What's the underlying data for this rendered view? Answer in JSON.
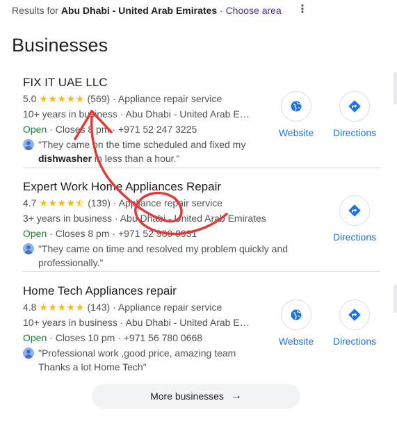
{
  "header": {
    "results_prefix": "Results for ",
    "location": "Abu Dhabi - United Arab Emirates",
    "separator": " · ",
    "choose_area": "Choose area",
    "menu_icon": "more-vert-icon"
  },
  "section_title": "Businesses",
  "businesses": [
    {
      "name": "FIX IT UAE LLC",
      "rating": "5.0",
      "stars": "★★★★★",
      "reviews": "(569)",
      "category": "Appliance repair service",
      "experience": "10+ years in business",
      "address": "Abu Dhabi - United Arab E…",
      "status": "Open",
      "hours": "Closes 8 pm",
      "phone": "+971 52 247 3225",
      "review_text": "\"They came on the time scheduled and fixed my ",
      "review_bold": "dishwasher",
      "review_tail": " in less than a hour.\"",
      "website_label": "Website",
      "directions_label": "Directions"
    },
    {
      "name": "Expert Work Home Appliances Repair",
      "rating": "4.7",
      "stars": "★★★★⯪",
      "reviews": "(139)",
      "category": "Appliance repair service",
      "experience": "3+ years in business",
      "address": "Abu Dhabi - United Arab Emirates",
      "status": "Open",
      "hours": "Closes 8 pm",
      "phone": "+971 52 980 0931",
      "review_text": "\"They came on time and resolved my problem quickly and professionally.\"",
      "directions_label": "Directions"
    },
    {
      "name": "Home Tech Appliances repair",
      "rating": "4.8",
      "stars": "★★★★★",
      "reviews": "(143)",
      "category": "Appliance repair service",
      "experience": "10+ years in business",
      "address": "Abu Dhabi - United Arab E…",
      "status": "Open",
      "hours": "Closes 10 pm",
      "phone": "+971 56 780 0668",
      "review_text": "\"Professional work ,good price, amazing team Thanks a lot Home Tech\"",
      "website_label": "Website",
      "directions_label": "Directions"
    }
  ],
  "more_button": "More businesses",
  "colors": {
    "star": "#fbbc04",
    "open": "#188038",
    "link": "#1a73e8",
    "annotation": "#e53935"
  }
}
